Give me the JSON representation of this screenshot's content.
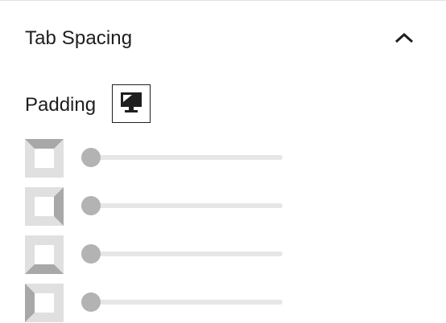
{
  "section": {
    "title": "Tab Spacing",
    "collapse_icon": "chevron-up-icon"
  },
  "padding": {
    "label": "Padding",
    "device_icon": "desktop-icon",
    "sides": [
      {
        "side": "top",
        "icon": "padding-top-icon",
        "value": 0
      },
      {
        "side": "right",
        "icon": "padding-right-icon",
        "value": 0
      },
      {
        "side": "bottom",
        "icon": "padding-bottom-icon",
        "value": 0
      },
      {
        "side": "left",
        "icon": "padding-left-icon",
        "value": 0
      }
    ]
  },
  "colors": {
    "text": "#1e1e1e",
    "icon_light": "#e0e0e0",
    "icon_dark": "#a8a8a8",
    "track": "#e6e6e6",
    "thumb": "#b3b3b3"
  }
}
